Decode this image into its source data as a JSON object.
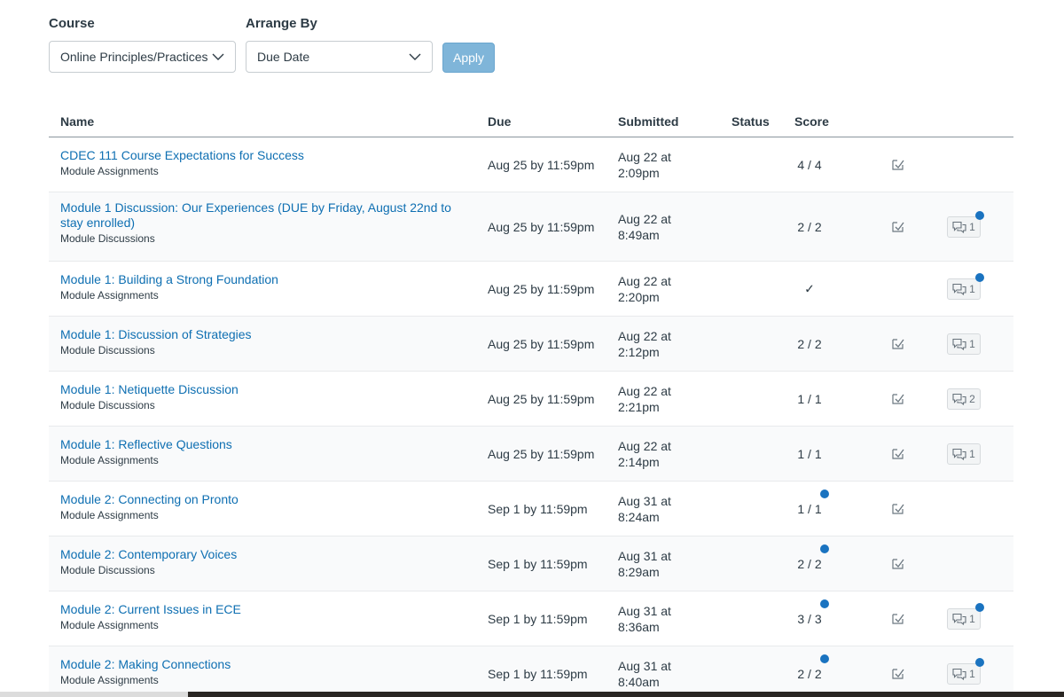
{
  "filters": {
    "course_label": "Course",
    "course_value": "Online Principles/Practices",
    "arrange_label": "Arrange By",
    "arrange_value": "Due Date",
    "apply_label": "Apply"
  },
  "columns": {
    "name": "Name",
    "due": "Due",
    "submitted": "Submitted",
    "status": "Status",
    "score": "Score"
  },
  "colors": {
    "link": "#0e6fb2",
    "unread_dot": "#1a73c0",
    "apply_button": "#7fb5d9"
  },
  "rows": [
    {
      "title": "CDEC 111 Course Expectations for Success",
      "type": "Module Assignments",
      "due": "Aug 25 by 11:59pm",
      "submitted_1": "Aug 22 at",
      "submitted_2": "2:09pm",
      "score": "4 / 4",
      "score_unread": false,
      "rubric_icon": "rubric-icon",
      "comments": "",
      "comment_unread": false
    },
    {
      "title": "Module 1 Discussion: Our Experiences (DUE by Friday, August 22nd to stay enrolled)",
      "type": "Module Discussions",
      "due": "Aug 25 by 11:59pm",
      "submitted_1": "Aug 22 at",
      "submitted_2": "8:49am",
      "score": "2 / 2",
      "score_unread": false,
      "rubric_icon": "rubric-icon",
      "comments": "1",
      "comment_unread": true
    },
    {
      "title": "Module 1: Building a Strong Foundation",
      "type": "Module Assignments",
      "due": "Aug 25 by 11:59pm",
      "submitted_1": "Aug 22 at",
      "submitted_2": "2:20pm",
      "score": "✓",
      "score_unread": false,
      "rubric_icon": "",
      "comments": "1",
      "comment_unread": true
    },
    {
      "title": "Module 1: Discussion of Strategies",
      "type": "Module Discussions",
      "due": "Aug 25 by 11:59pm",
      "submitted_1": "Aug 22 at",
      "submitted_2": "2:12pm",
      "score": "2 / 2",
      "score_unread": false,
      "rubric_icon": "rubric-icon",
      "comments": "1",
      "comment_unread": false
    },
    {
      "title": "Module 1: Netiquette Discussion",
      "type": "Module Discussions",
      "due": "Aug 25 by 11:59pm",
      "submitted_1": "Aug 22 at",
      "submitted_2": "2:21pm",
      "score": "1 / 1",
      "score_unread": false,
      "rubric_icon": "rubric-icon",
      "comments": "2",
      "comment_unread": false
    },
    {
      "title": "Module 1: Reflective Questions",
      "type": "Module Assignments",
      "due": "Aug 25 by 11:59pm",
      "submitted_1": "Aug 22 at",
      "submitted_2": "2:14pm",
      "score": "1 / 1",
      "score_unread": false,
      "rubric_icon": "rubric-icon",
      "comments": "1",
      "comment_unread": false
    },
    {
      "title": "Module 2: Connecting on Pronto",
      "type": "Module Assignments",
      "due": "Sep 1 by 11:59pm",
      "submitted_1": "Aug 31 at",
      "submitted_2": "8:24am",
      "score": "1 / 1",
      "score_unread": true,
      "rubric_icon": "rubric-icon",
      "comments": "",
      "comment_unread": false
    },
    {
      "title": "Module 2: Contemporary Voices",
      "type": "Module Discussions",
      "due": "Sep 1 by 11:59pm",
      "submitted_1": "Aug 31 at",
      "submitted_2": "8:29am",
      "score": "2 / 2",
      "score_unread": true,
      "rubric_icon": "rubric-icon",
      "comments": "",
      "comment_unread": false
    },
    {
      "title": "Module 2: Current Issues in ECE",
      "type": "Module Assignments",
      "due": "Sep 1 by 11:59pm",
      "submitted_1": "Aug 31 at",
      "submitted_2": "8:36am",
      "score": "3 / 3",
      "score_unread": true,
      "rubric_icon": "rubric-icon",
      "comments": "1",
      "comment_unread": true
    },
    {
      "title": "Module 2: Making Connections",
      "type": "Module Assignments",
      "due": "Sep 1 by 11:59pm",
      "submitted_1": "Aug 31 at",
      "submitted_2": "8:40am",
      "score": "2 / 2",
      "score_unread": true,
      "rubric_icon": "rubric-icon",
      "comments": "1",
      "comment_unread": true
    }
  ]
}
